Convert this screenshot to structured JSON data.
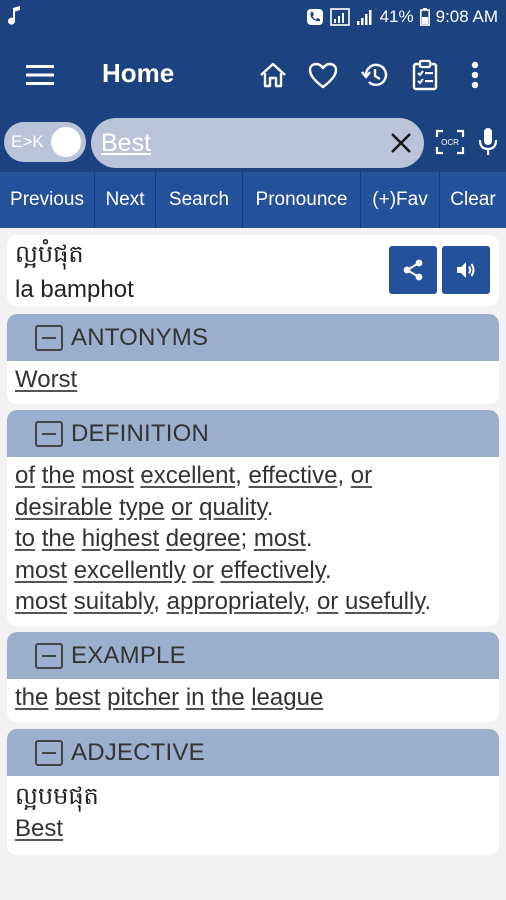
{
  "status_bar": {
    "music_icon": "music-note-icon",
    "battery_percent": "41%",
    "time": "9:08 AM"
  },
  "app_bar": {
    "title": "Home",
    "icons": [
      "menu-icon",
      "home-icon",
      "heart-icon",
      "history-icon",
      "clipboard-icon",
      "more-vert-icon"
    ]
  },
  "search": {
    "toggle_label": "E>K",
    "value": "Best"
  },
  "buttons": [
    "Previous",
    "Next",
    "Search",
    "Pronounce",
    "(+)Fav",
    "Clear"
  ],
  "word": {
    "khmer": "ល្អបំផុត",
    "romanization": "la bamphot"
  },
  "sections": {
    "antonyms": {
      "title": "ANTONYMS",
      "lines": [
        [
          [
            "Worst",
            true
          ]
        ]
      ]
    },
    "definition": {
      "title": "DEFINITION",
      "lines": [
        [
          [
            "of",
            true
          ],
          [
            " ",
            false
          ],
          [
            "the",
            true
          ],
          [
            " ",
            false
          ],
          [
            "most",
            true
          ],
          [
            " ",
            false
          ],
          [
            "excellent",
            true
          ],
          [
            ", ",
            false
          ],
          [
            "effective",
            true
          ],
          [
            ", ",
            false
          ],
          [
            "or",
            true
          ]
        ],
        [
          [
            "desirable",
            true
          ],
          [
            " ",
            false
          ],
          [
            "type",
            true
          ],
          [
            " ",
            false
          ],
          [
            "or",
            true
          ],
          [
            " ",
            false
          ],
          [
            "quality",
            true
          ],
          [
            ".",
            false
          ]
        ],
        [
          [
            "to",
            true
          ],
          [
            " ",
            false
          ],
          [
            "the",
            true
          ],
          [
            " ",
            false
          ],
          [
            "highest",
            true
          ],
          [
            " ",
            false
          ],
          [
            "degree",
            true
          ],
          [
            "; ",
            false
          ],
          [
            "most",
            true
          ],
          [
            ".",
            false
          ]
        ],
        [
          [
            "most",
            true
          ],
          [
            " ",
            false
          ],
          [
            "excellently",
            true
          ],
          [
            " ",
            false
          ],
          [
            "or",
            true
          ],
          [
            " ",
            false
          ],
          [
            "effectively",
            true
          ],
          [
            ".",
            false
          ]
        ],
        [
          [
            "most",
            true
          ],
          [
            " ",
            false
          ],
          [
            "suitably",
            true
          ],
          [
            ", ",
            false
          ],
          [
            "appropriately",
            true
          ],
          [
            ", ",
            false
          ],
          [
            "or",
            true
          ],
          [
            " ",
            false
          ],
          [
            "usefully",
            true
          ],
          [
            ".",
            false
          ]
        ]
      ]
    },
    "example": {
      "title": "EXAMPLE",
      "lines": [
        [
          [
            "the",
            true
          ],
          [
            " ",
            false
          ],
          [
            "best",
            true
          ],
          [
            " ",
            false
          ],
          [
            "pitcher",
            true
          ],
          [
            " ",
            false
          ],
          [
            "in",
            true
          ],
          [
            " ",
            false
          ],
          [
            "the",
            true
          ],
          [
            " ",
            false
          ],
          [
            "league",
            true
          ]
        ]
      ]
    },
    "adjective": {
      "title": "ADJECTIVE",
      "khmer": "ល្អបមផុត",
      "lines": [
        [
          [
            "Best",
            true
          ]
        ]
      ]
    }
  },
  "colors": {
    "primary": "#1c4280",
    "button_bar": "#24519a",
    "section_header": "#9cafcc",
    "search_field": "#b9c4d8"
  }
}
